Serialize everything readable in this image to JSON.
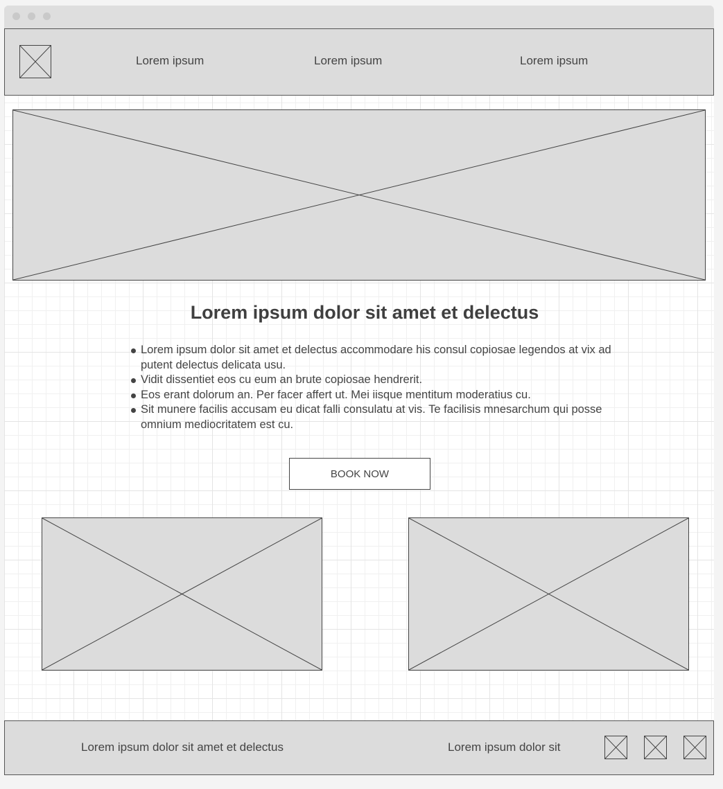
{
  "header": {
    "nav": [
      "Lorem ipsum",
      "Lorem ipsum",
      "Lorem ipsum"
    ]
  },
  "main": {
    "title": "Lorem ipsum dolor sit amet et delectus",
    "bullets": [
      "Lorem ipsum dolor sit amet et delectus accommodare his consul copiosae legendos at vix ad putent delectus delicata usu.",
      "Vidit dissentiet eos cu eum an brute copiosae hendrerit.",
      "Eos erant dolorum an. Per facer affert ut. Mei iisque mentitum moderatius cu.",
      "Sit munere facilis accusam eu dicat falli consulatu at vis. Te facilisis mnesarchum qui posse omnium mediocritatem est cu."
    ],
    "cta_label": "BOOK NOW"
  },
  "footer": {
    "left_text": "Lorem ipsum dolor sit amet et delectus",
    "right_text": "Lorem ipsum dolor sit"
  },
  "colors": {
    "placeholder_fill": "#dcdcdc",
    "stroke": "#444444",
    "text": "#444444"
  }
}
